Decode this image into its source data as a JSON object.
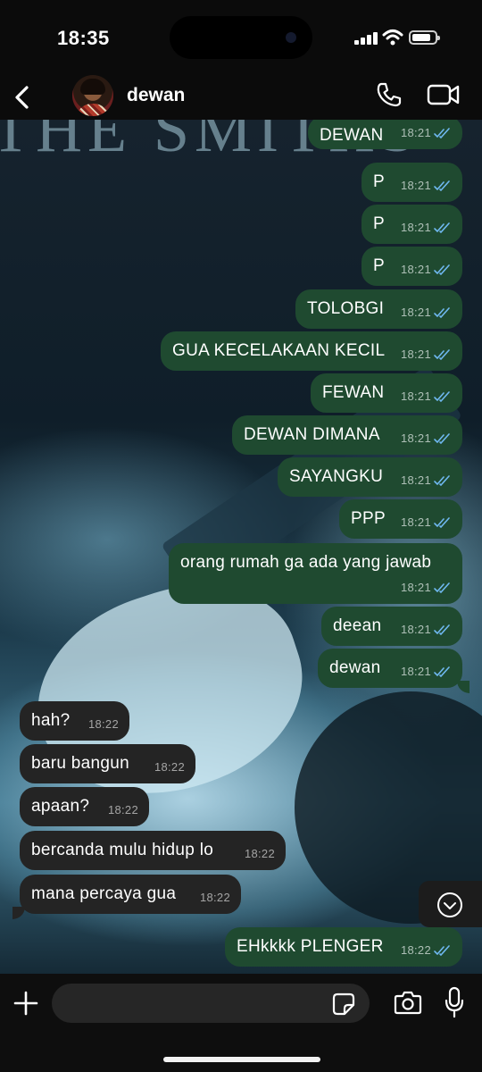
{
  "status_bar": {
    "time": "18:35"
  },
  "header": {
    "contact_name": "dewan",
    "icons": [
      "back-chevron-icon",
      "avatar",
      "phone-icon",
      "video-camera-icon"
    ]
  },
  "colors": {
    "outgoing_bubble": "#1f4a30",
    "incoming_bubble": "#242424",
    "read_ticks": "#6fb8f0"
  },
  "messages": [
    {
      "dir": "out",
      "text": "DEWAN",
      "time": "18:21",
      "read": true
    },
    {
      "dir": "out",
      "text": "P",
      "time": "18:21",
      "read": true
    },
    {
      "dir": "out",
      "text": "P",
      "time": "18:21",
      "read": true
    },
    {
      "dir": "out",
      "text": "P",
      "time": "18:21",
      "read": true
    },
    {
      "dir": "out",
      "text": "TOLOBGI",
      "time": "18:21",
      "read": true
    },
    {
      "dir": "out",
      "text": "GUA KECELAKAAN KECIL",
      "time": "18:21",
      "read": true
    },
    {
      "dir": "out",
      "text": "FEWAN",
      "time": "18:21",
      "read": true
    },
    {
      "dir": "out",
      "text": "DEWAN DIMANA",
      "time": "18:21",
      "read": true
    },
    {
      "dir": "out",
      "text": "SAYANGKU",
      "time": "18:21",
      "read": true
    },
    {
      "dir": "out",
      "text": "PPP",
      "time": "18:21",
      "read": true
    },
    {
      "dir": "out",
      "text": "orang rumah ga ada yang jawab",
      "time": "18:21",
      "read": true
    },
    {
      "dir": "out",
      "text": "deean",
      "time": "18:21",
      "read": true
    },
    {
      "dir": "out",
      "text": "dewan",
      "time": "18:21",
      "read": true
    },
    {
      "dir": "in",
      "text": "hah?",
      "time": "18:22"
    },
    {
      "dir": "in",
      "text": "baru bangun",
      "time": "18:22"
    },
    {
      "dir": "in",
      "text": "apaan?",
      "time": "18:22"
    },
    {
      "dir": "in",
      "text": "bercanda mulu hidup lo",
      "time": "18:22"
    },
    {
      "dir": "in",
      "text": "mana percaya gua",
      "time": "18:22"
    },
    {
      "dir": "out",
      "text": "EHkkkk PLENGER",
      "time": "18:22",
      "read": true
    }
  ],
  "wallpaper": {
    "text": "THE SMITHS"
  },
  "input_bar": {
    "placeholder": "",
    "icons": [
      "plus-icon",
      "sticker-icon",
      "camera-icon",
      "microphone-icon"
    ]
  }
}
